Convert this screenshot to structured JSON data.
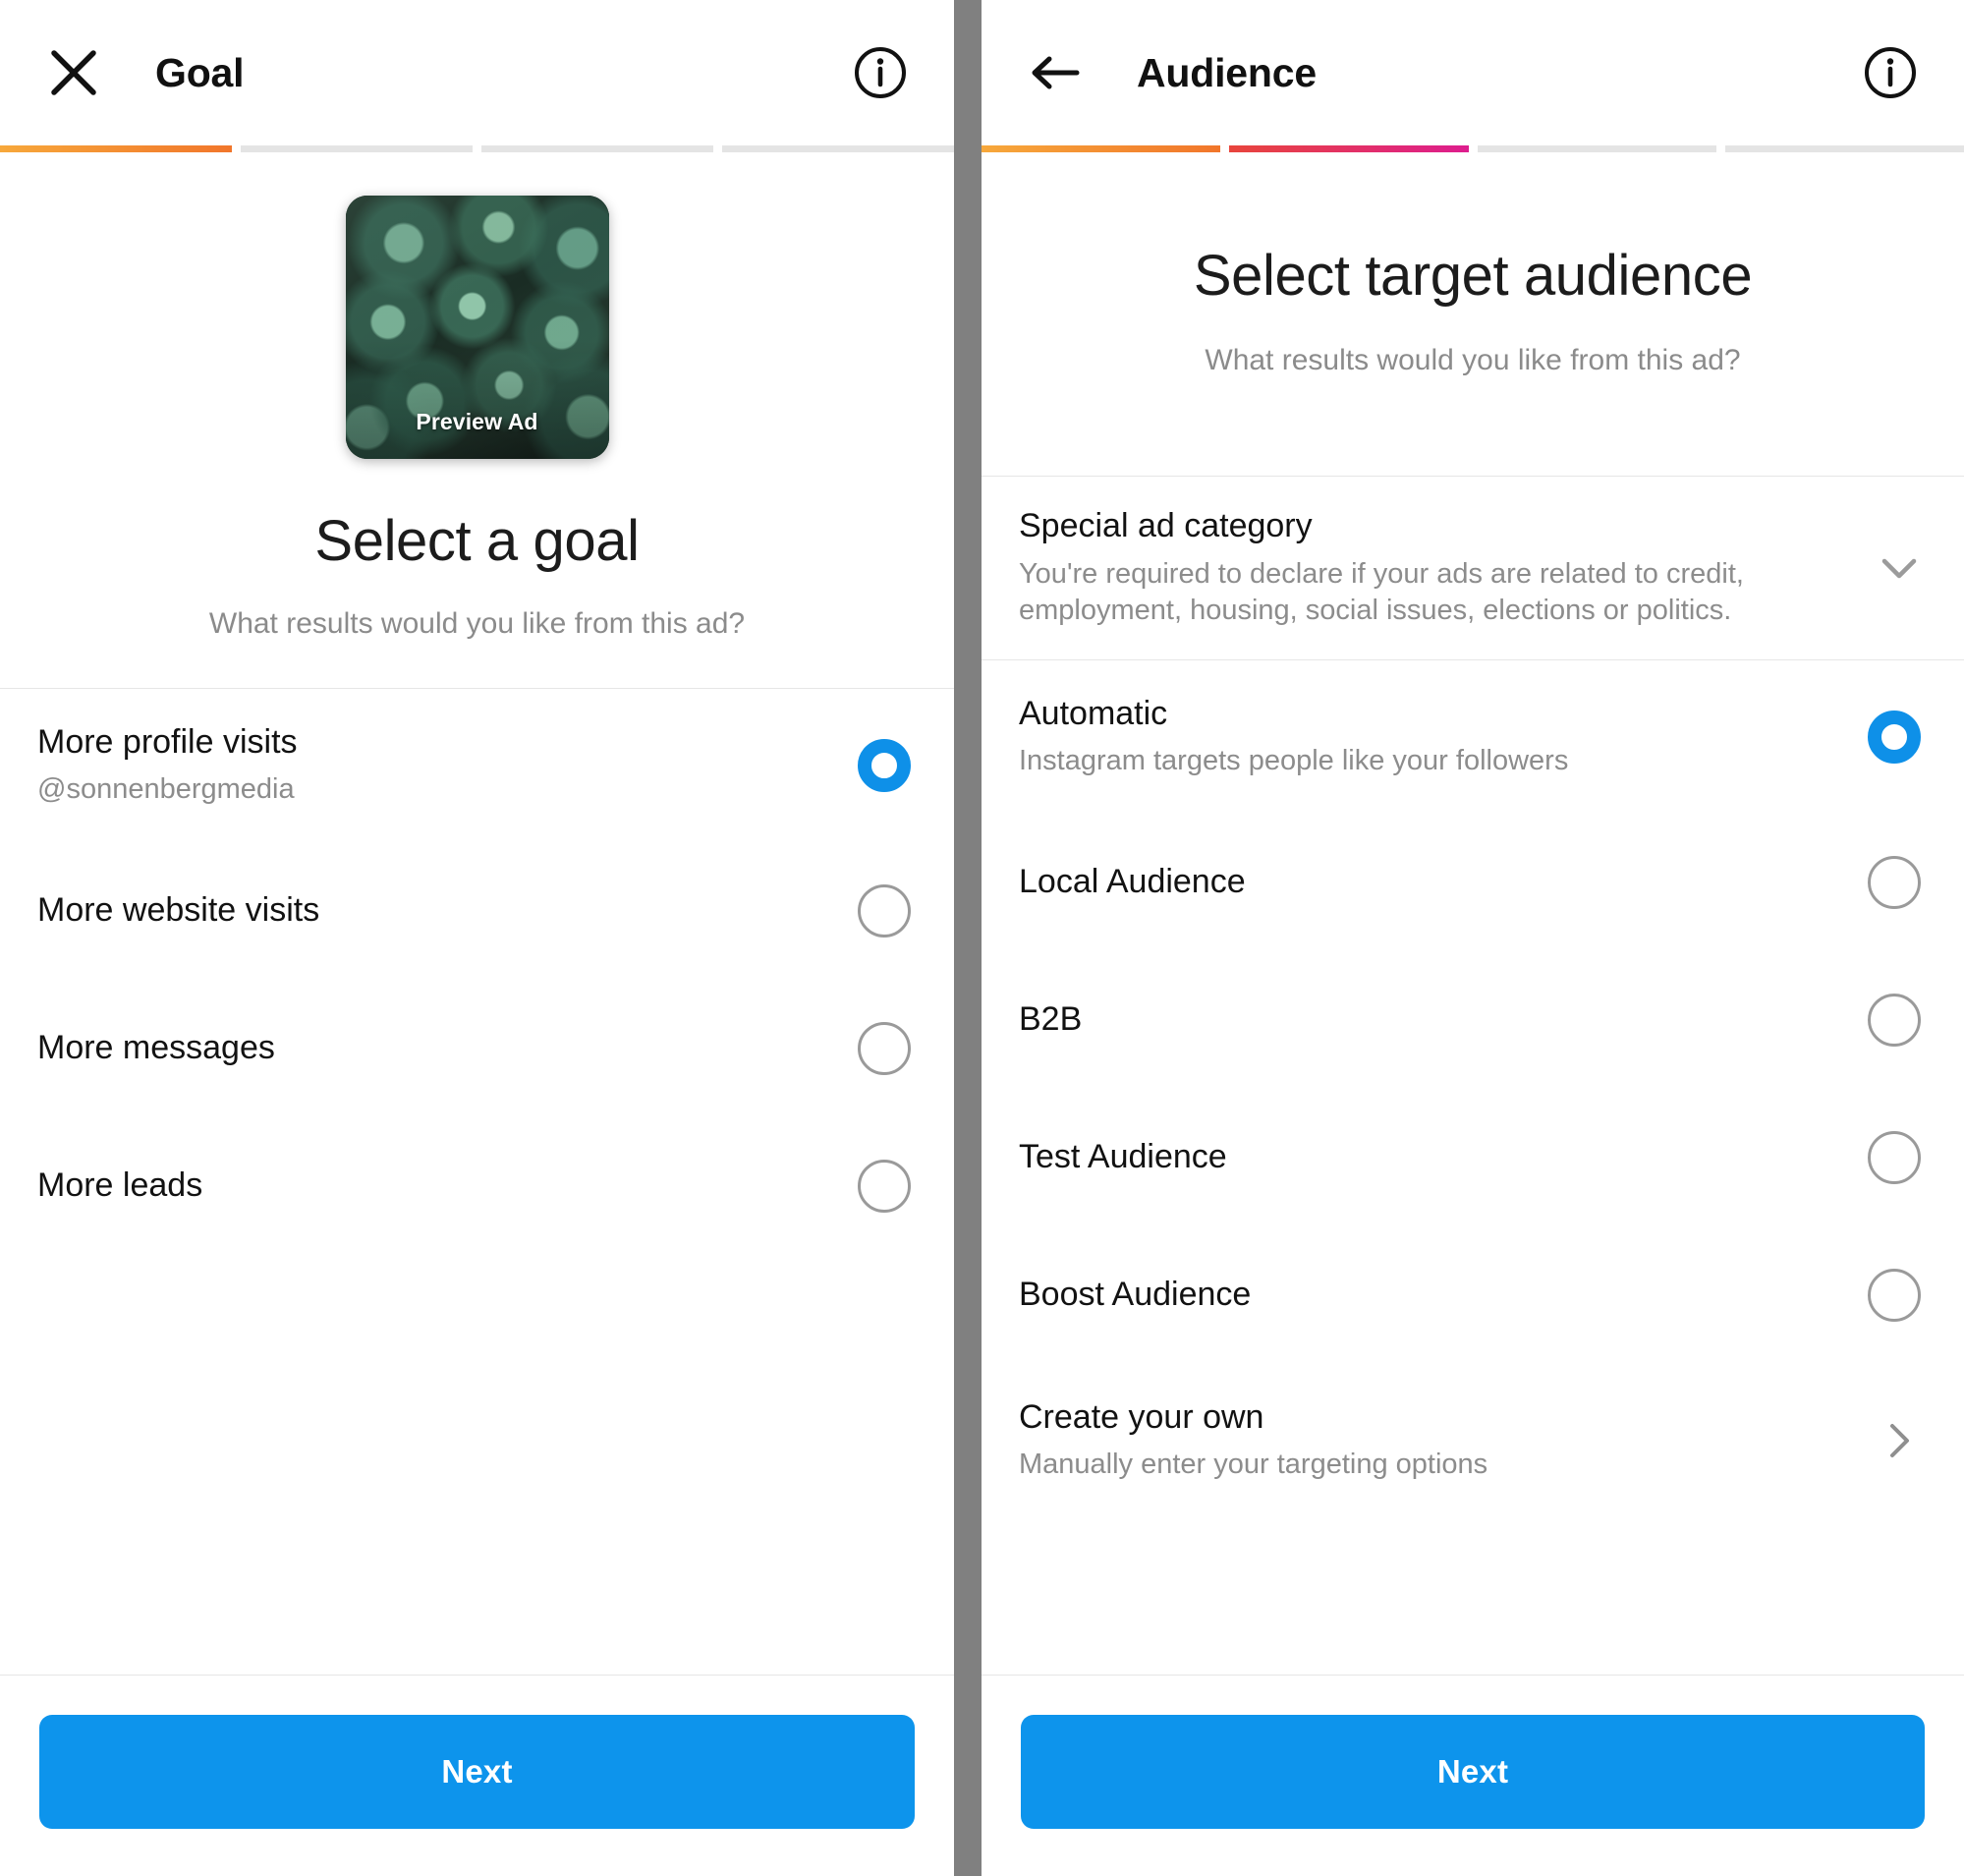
{
  "goal_screen": {
    "header": {
      "title": "Goal",
      "close_icon": "close-icon",
      "info_icon": "info-icon"
    },
    "progress": {
      "total_steps": 4,
      "filled_steps": 1
    },
    "preview": {
      "label": "Preview Ad",
      "image_description": "succulent plants photo"
    },
    "title": "Select a goal",
    "subtitle": "What results would you like from this ad?",
    "options": [
      {
        "label": "More profile visits",
        "sublabel": "@sonnenbergmedia",
        "selected": true
      },
      {
        "label": "More website visits",
        "sublabel": "",
        "selected": false
      },
      {
        "label": "More messages",
        "sublabel": "",
        "selected": false
      },
      {
        "label": "More leads",
        "sublabel": "",
        "selected": false
      }
    ],
    "next_label": "Next"
  },
  "audience_screen": {
    "header": {
      "title": "Audience",
      "back_icon": "back-arrow-icon",
      "info_icon": "info-icon"
    },
    "progress": {
      "total_steps": 4,
      "filled_steps": 2
    },
    "title": "Select target audience",
    "subtitle": "What results would you like from this ad?",
    "special_ad_category": {
      "label": "Special ad category",
      "description": "You're required to declare if your ads are related to credit, employment, housing, social issues, elections or politics.",
      "accessory_icon": "chevron-down-icon"
    },
    "options": [
      {
        "label": "Automatic",
        "sublabel": "Instagram targets people like your followers",
        "selected": true
      },
      {
        "label": "Local Audience",
        "sublabel": "",
        "selected": false
      },
      {
        "label": "B2B",
        "sublabel": "",
        "selected": false
      },
      {
        "label": "Test Audience",
        "sublabel": "",
        "selected": false
      },
      {
        "label": "Boost Audience",
        "sublabel": "",
        "selected": false
      }
    ],
    "create_your_own": {
      "label": "Create your own",
      "sublabel": "Manually enter your targeting options",
      "accessory_icon": "chevron-right-icon"
    },
    "next_label": "Next"
  },
  "colors": {
    "accent_blue": "#0d94ec",
    "progress_step1_start": "#f7a83b",
    "progress_step1_end": "#f1762b",
    "progress_step2_start": "#e8453c",
    "progress_step2_end": "#dd1d8e",
    "progress_empty": "#e4e4e4",
    "muted_text": "#8c8c8c"
  }
}
